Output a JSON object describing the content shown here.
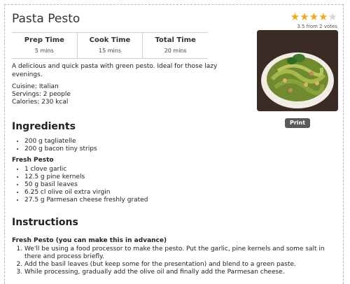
{
  "recipe": {
    "title": "Pasta Pesto",
    "rating_text": "3.5 from 2 votes",
    "rating_value": 3.5,
    "rating_max": 5,
    "description": "A delicious and quick pasta with green pesto. Ideal for those lazy evenings.",
    "cuisine": "Cuisine: Italian",
    "servings": "Servings: 2 people",
    "calories": "Calories: 230 kcal",
    "print_label": "Print"
  },
  "times": [
    {
      "label": "Prep Time",
      "value": "5 mins"
    },
    {
      "label": "Cook Time",
      "value": "15 mins"
    },
    {
      "label": "Total Time",
      "value": "20 mins"
    }
  ],
  "ingredients": {
    "heading": "Ingredients",
    "main": [
      "200 g tagliatelle",
      "200 g bacon tiny strips"
    ],
    "group_title": "Fresh Pesto",
    "pesto": [
      "1 clove garlic",
      "12.5 g pine kernels",
      "50 g basil leaves",
      "6.25 cl olive oil extra virgin",
      "27.5 g Parmesan cheese freshly grated"
    ]
  },
  "instructions": {
    "heading": "Instructions",
    "group_title": "Fresh Pesto (you can make this in advance)",
    "steps": [
      "We'll be using a food processor to make the pesto. Put the garlic, pine kernels and some salt in there and process briefly.",
      "Add the basil leaves (but keep some for the presentation) and blend to a green paste.",
      "While processing, gradually add the olive oil and finally add the Parmesan cheese."
    ]
  },
  "colors": {
    "star": "#f2a81d",
    "button": "#5a5a5a"
  }
}
